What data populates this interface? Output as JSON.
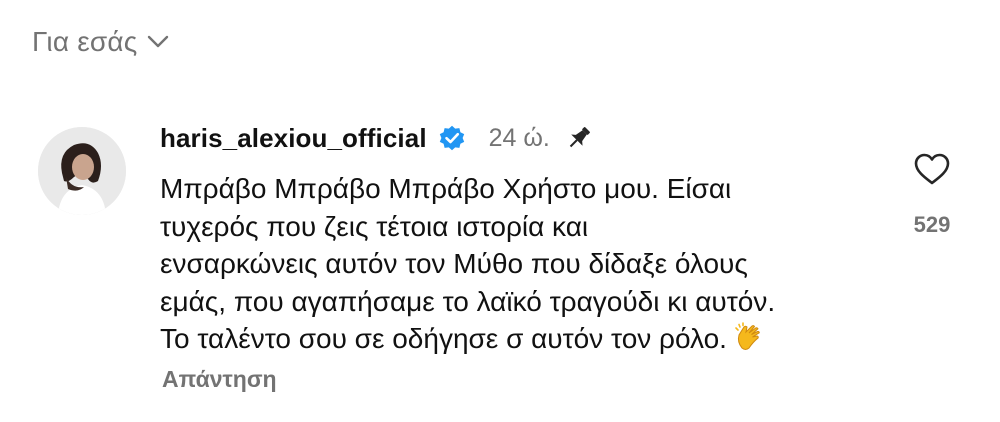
{
  "sort": {
    "label": "Για εσάς",
    "icon": "chevron-down-icon"
  },
  "comment": {
    "username": "haris_alexiou_official",
    "verified_icon": "verified-badge-icon",
    "time": "24 ώ.",
    "pinned_icon": "pin-icon",
    "lines": [
      "Μπράβο Μπράβο Μπράβο Χρήστο μου. Είσαι",
      "τυχερός που ζεις τέτοια ιστορία  και",
      "ενσαρκώνεις αυτόν τον Μύθο που δίδαξε όλους",
      "εμάς, που αγαπήσαμε το λαϊκό τραγούδι κι αυτόν.",
      "Το ταλέντο σου σε οδήγησε σ αυτόν τον ρόλο."
    ],
    "emoji": "clapping-hands-emoji",
    "reply_label": "Απάντηση",
    "likes": "529",
    "like_icon": "heart-icon"
  },
  "colors": {
    "verified": "#2196f3",
    "muted": "#737373",
    "text": "#111111"
  }
}
